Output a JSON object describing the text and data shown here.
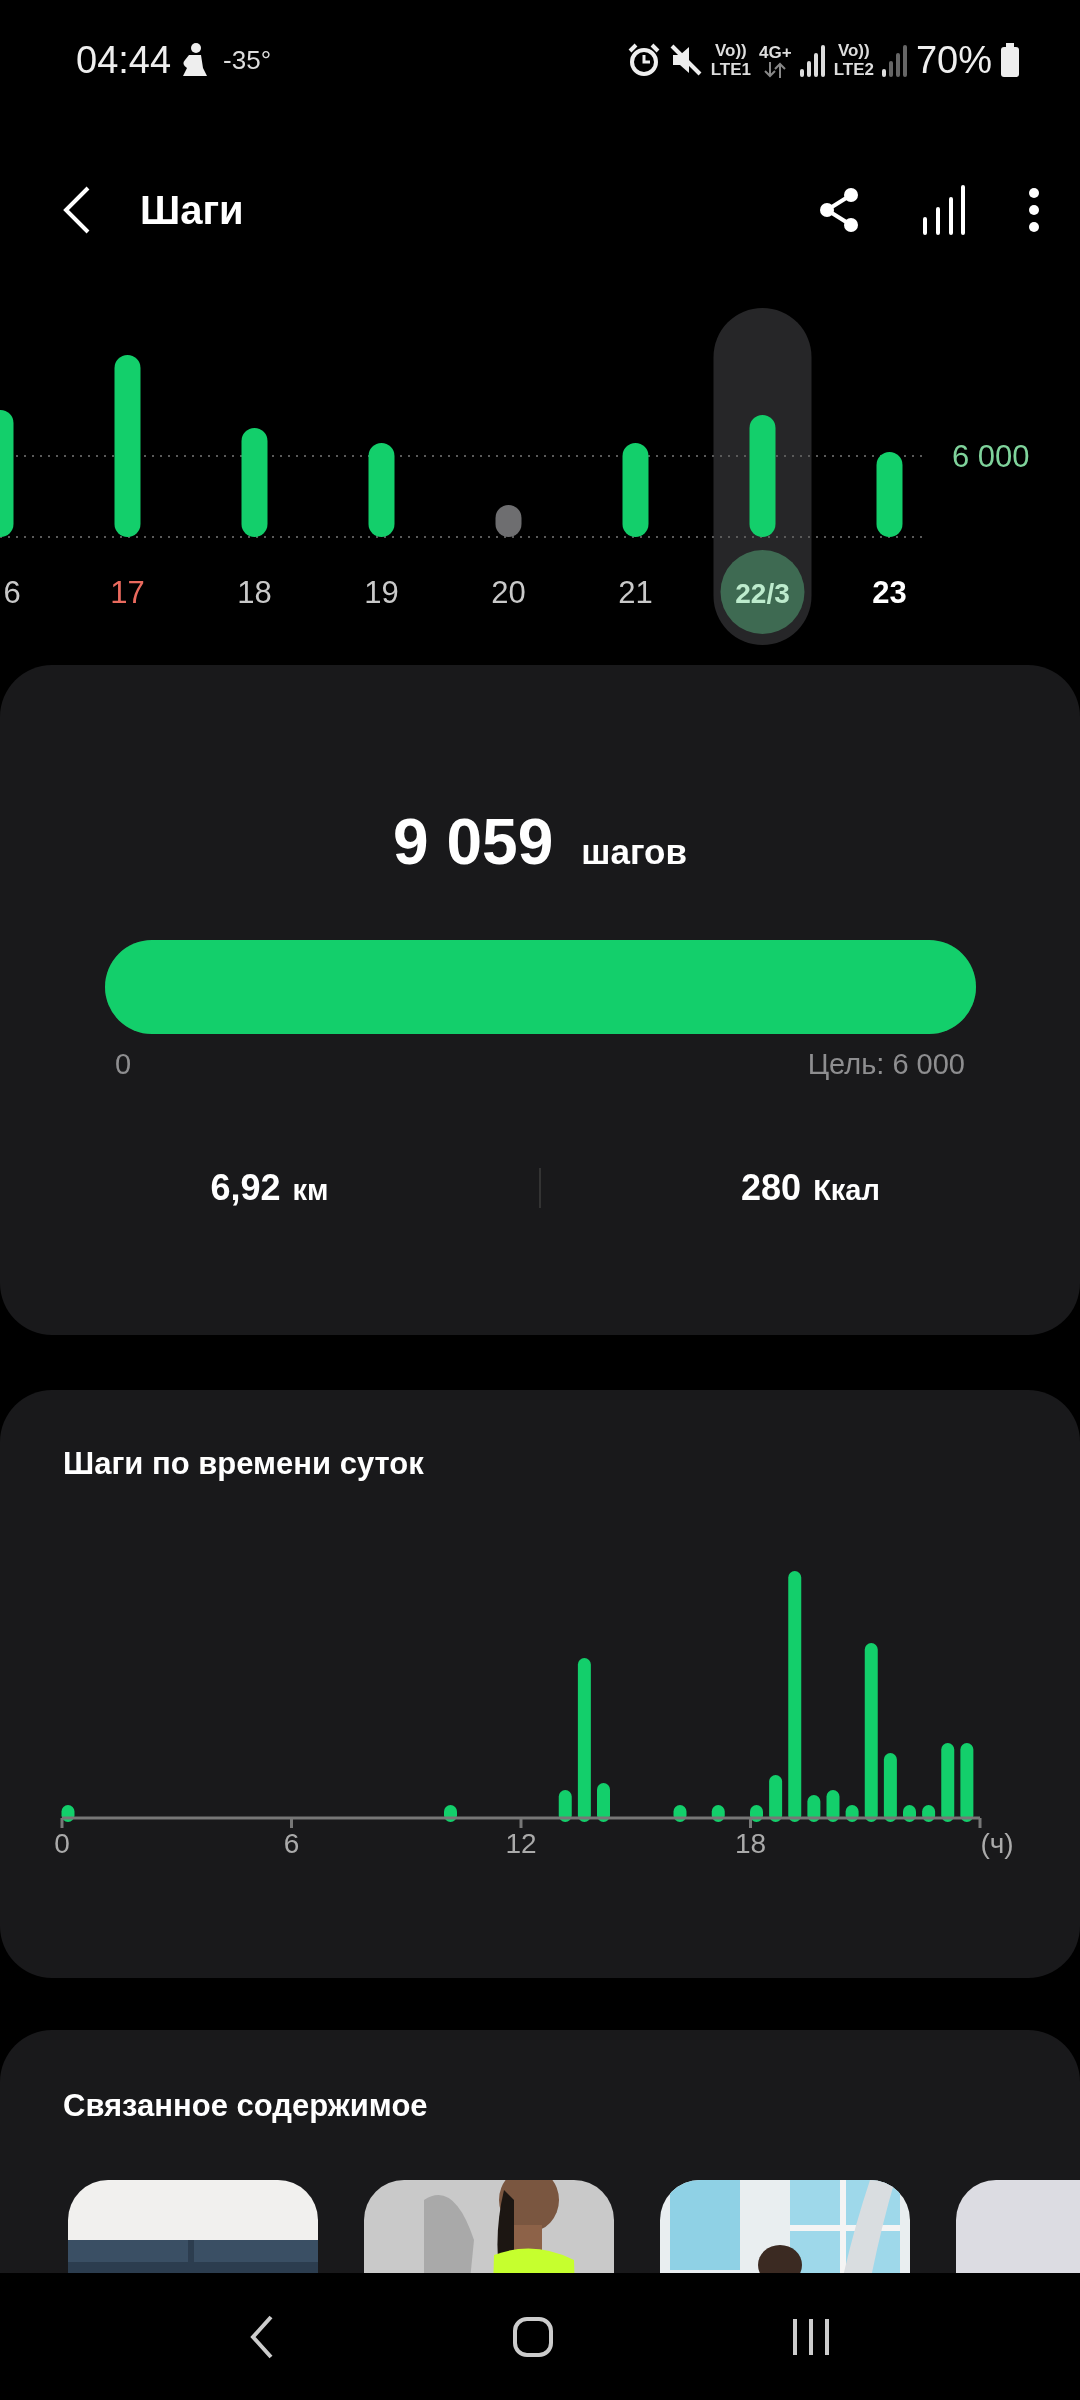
{
  "status_bar": {
    "time": "04:44",
    "temperature": "-35°",
    "sim1_volte": "Vo))",
    "sim1_label": "LTE1",
    "network": "4G+",
    "sim2_volte": "Vo))",
    "sim2_label": "LTE2",
    "battery": "70%"
  },
  "app_bar": {
    "title": "Шаги"
  },
  "daily_chart": {
    "goal_label": "6 000",
    "days": [
      {
        "label": "6",
        "kind": "normal",
        "color": "#13cf6b",
        "selected": false
      },
      {
        "label": "17",
        "kind": "weekend",
        "color": "#13cf6b",
        "selected": false
      },
      {
        "label": "18",
        "kind": "normal",
        "color": "#13cf6b",
        "selected": false
      },
      {
        "label": "19",
        "kind": "normal",
        "color": "#13cf6b",
        "selected": false
      },
      {
        "label": "20",
        "kind": "normal",
        "color": "#6e6e70",
        "selected": false
      },
      {
        "label": "21",
        "kind": "normal",
        "color": "#13cf6b",
        "selected": false
      },
      {
        "label": "22/3",
        "kind": "normal",
        "color": "#13cf6b",
        "selected": true
      },
      {
        "label": "23",
        "kind": "today",
        "color": "#13cf6b",
        "selected": false
      }
    ]
  },
  "summary": {
    "steps": "9 059",
    "steps_unit": "шагов",
    "progress": {
      "level": 1,
      "start_label": "0",
      "goal_label": "Цель: 6 000"
    },
    "distance": {
      "value": "6,92",
      "unit": "км"
    },
    "calories": {
      "value": "280",
      "unit": "Ккал"
    }
  },
  "hourly": {
    "title": "Шаги по времени суток",
    "x_labels": [
      "0",
      "6",
      "12",
      "18",
      "(ч)"
    ]
  },
  "related": {
    "title": "Связанное содержимое"
  }
}
